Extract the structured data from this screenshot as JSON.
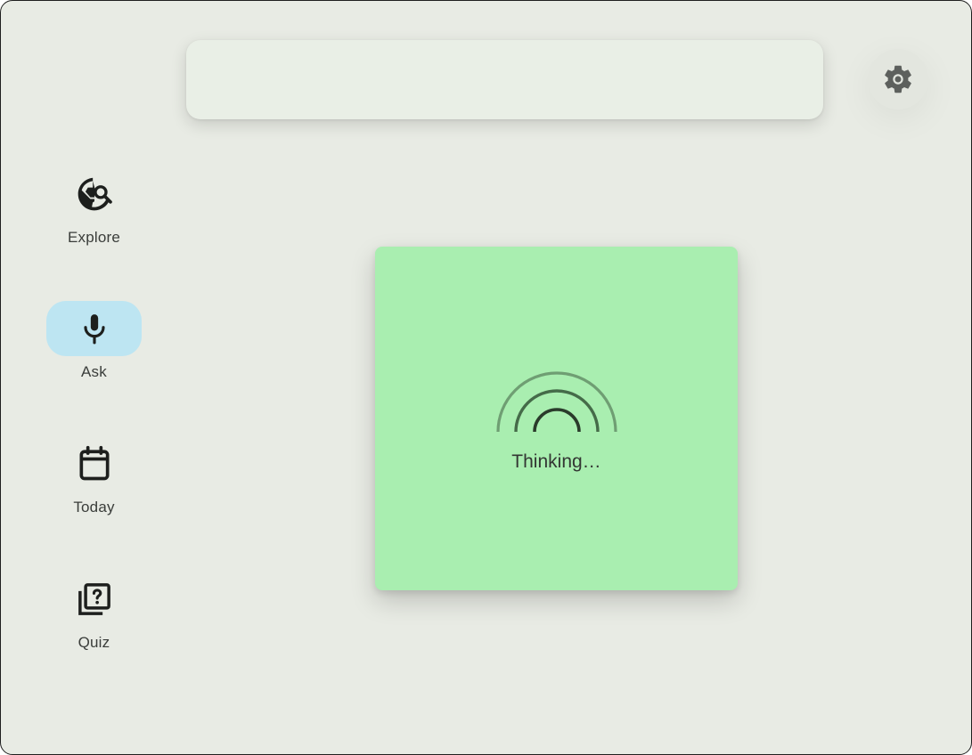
{
  "nav": {
    "items": [
      {
        "label": "Explore",
        "icon": "travel-explore-icon",
        "active": false
      },
      {
        "label": "Ask",
        "icon": "mic-icon",
        "active": true
      },
      {
        "label": "Today",
        "icon": "calendar-icon",
        "active": false
      },
      {
        "label": "Quiz",
        "icon": "quiz-icon",
        "active": false
      }
    ]
  },
  "search": {
    "value": ""
  },
  "settings": {
    "icon": "gear-icon"
  },
  "card": {
    "status_text": "Thinking…",
    "icon": "loading-arcs-icon"
  },
  "colors": {
    "background": "#e8ebe4",
    "active_indicator": "#bde5f2",
    "card": "#a9eeb0",
    "search_bar": "#e9efe6"
  }
}
